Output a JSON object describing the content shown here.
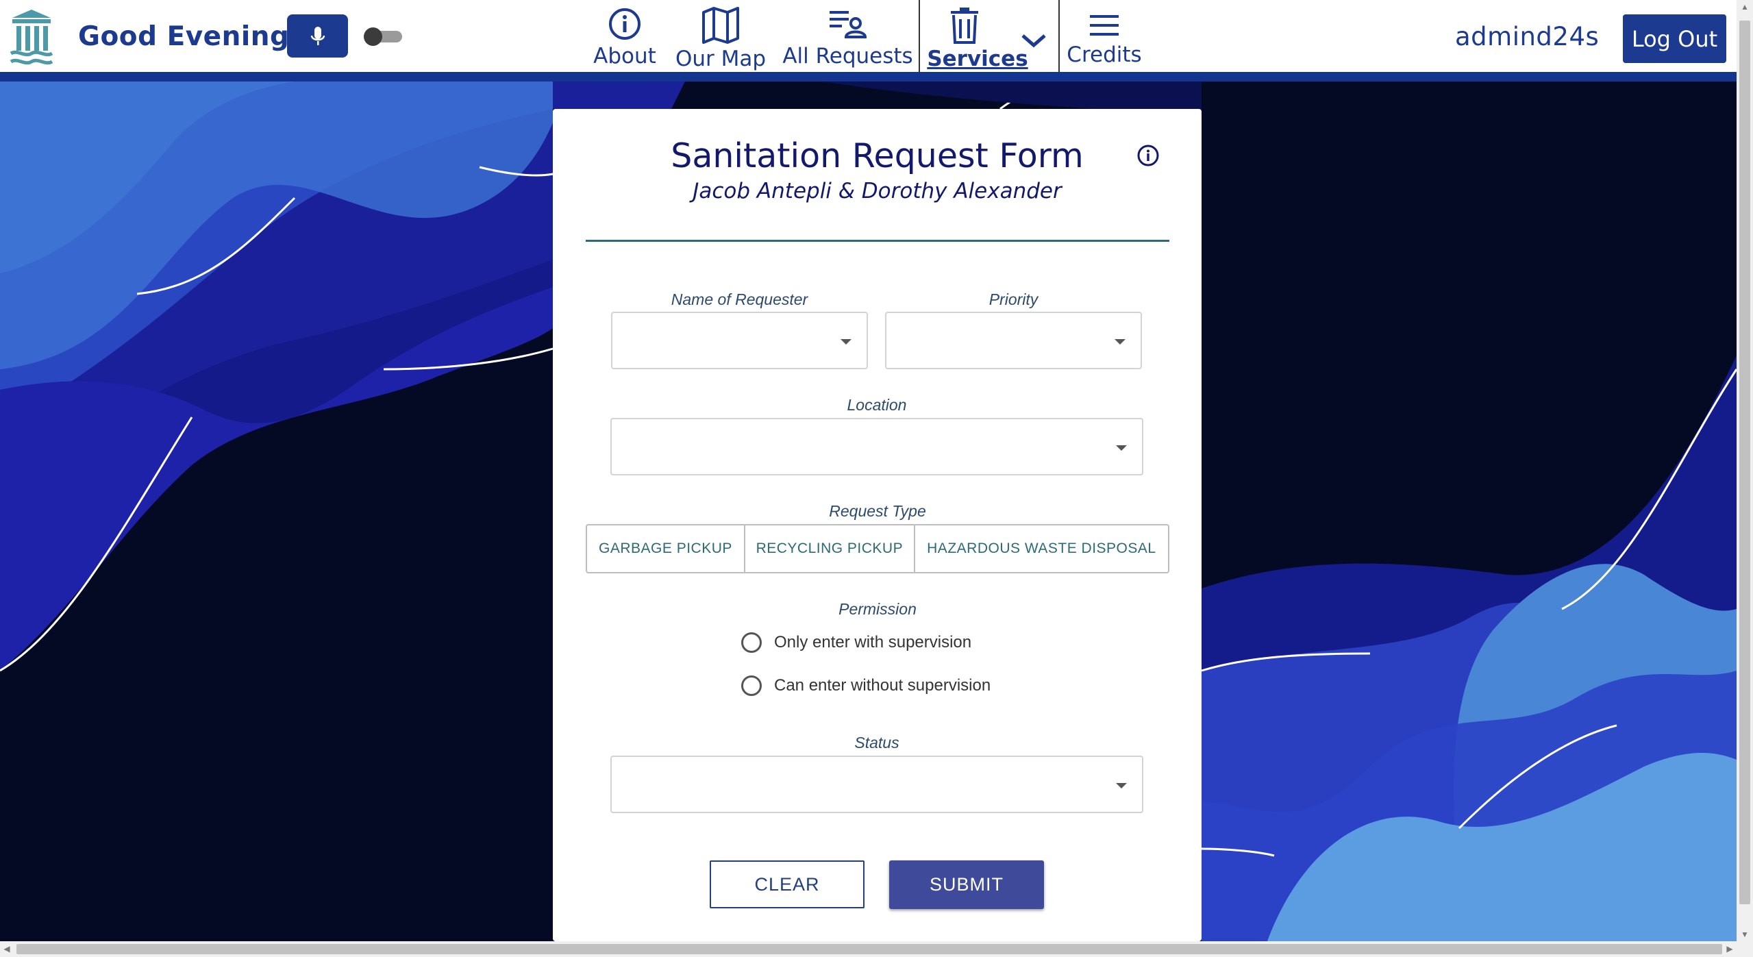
{
  "header": {
    "greeting": "Good Evening",
    "nav": {
      "about": "About",
      "map": "Our Map",
      "requests": "All Requests",
      "services": "Services",
      "credits": "Credits"
    },
    "username": "admind24s",
    "logout_label": "Log Out"
  },
  "form": {
    "title": "Sanitation Request Form",
    "authors": "Jacob Antepli & Dorothy Alexander",
    "fields": {
      "requester_label": "Name of Requester",
      "priority_label": "Priority",
      "location_label": "Location",
      "request_type_label": "Request Type",
      "permission_label": "Permission",
      "status_label": "Status"
    },
    "request_types": [
      "GARBAGE PICKUP",
      "RECYCLING PICKUP",
      "HAZARDOUS WASTE DISPOSAL"
    ],
    "permission_options": [
      "Only enter with supervision",
      "Can enter without supervision"
    ],
    "clear_label": "CLEAR",
    "submit_label": "SUBMIT"
  },
  "colors": {
    "brand": "#1c3a8f",
    "accent": "#2c6a75",
    "submit": "#3f4b9a"
  }
}
